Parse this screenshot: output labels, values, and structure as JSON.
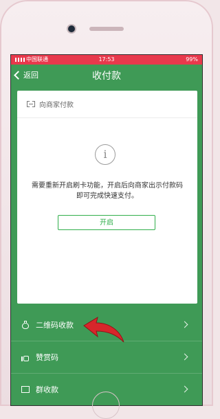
{
  "status_bar": {
    "carrier": "中国联通",
    "time": "17:53",
    "battery": "99%"
  },
  "nav": {
    "back_label": "返回",
    "title": "收付款"
  },
  "card": {
    "header_label": "向商家付款",
    "message": "需要重新开启刷卡功能，开启后向商家出示付款码即可完成快速支付。",
    "button_label": "开启"
  },
  "menu": {
    "items": [
      {
        "label": "二维码收款"
      },
      {
        "label": "赞赏码"
      },
      {
        "label": "群收款"
      }
    ]
  },
  "colors": {
    "header_green": "#3f9a56",
    "status_red": "#e8394c",
    "button_green": "#2fae4a",
    "annotation_red": "#d7262b"
  }
}
